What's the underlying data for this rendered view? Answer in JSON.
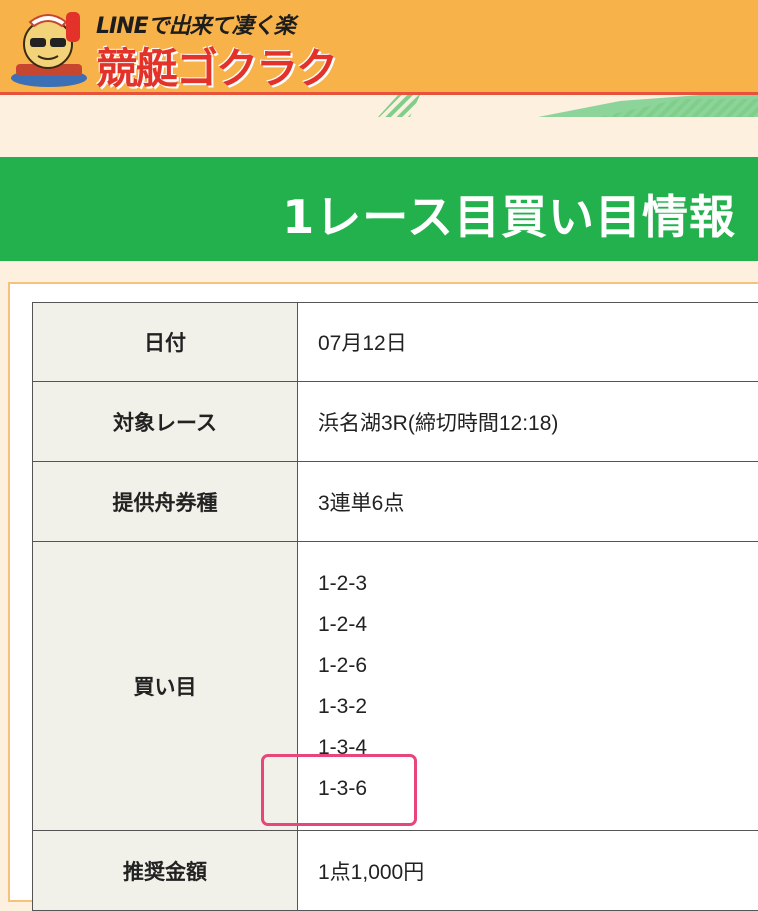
{
  "header": {
    "tagline": "LINEで出来て凄く楽",
    "title": "競艇ゴクラク"
  },
  "page_title": "1レース目買い目情報",
  "table": {
    "date_label": "日付",
    "date_value": "07月12日",
    "race_label": "対象レース",
    "race_value": "浜名湖3R(締切時間12:18)",
    "type_label": "提供舟券種",
    "type_value": "3連単6点",
    "picks_label": "買い目",
    "picks": [
      "1-2-3",
      "1-2-4",
      "1-2-6",
      "1-3-2",
      "1-3-4",
      "1-3-6"
    ],
    "amount_label": "推奨金額",
    "amount_value": "1点1,000円"
  },
  "colors": {
    "header_bg": "#f8b24a",
    "title_band": "#22b14c",
    "highlight": "#e8457a",
    "header_border": "#e7523b"
  }
}
